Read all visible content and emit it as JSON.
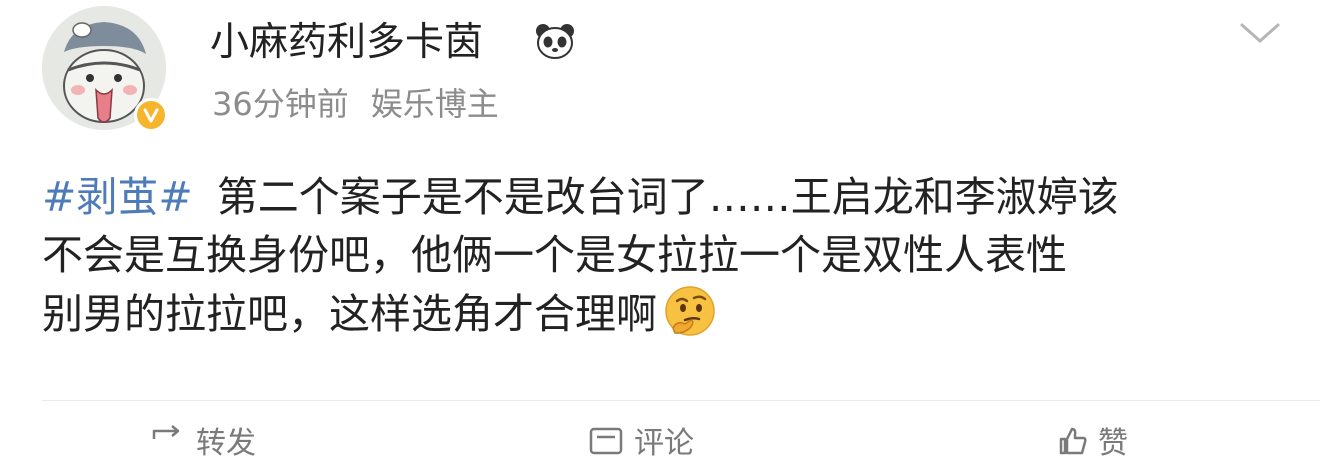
{
  "author": {
    "username": "小麻药利多卡茵",
    "badge_icon": "panda-icon",
    "verified_color": "#f6b52c"
  },
  "meta": {
    "time": "36分钟前",
    "source": "娱乐博主"
  },
  "post": {
    "hashtag": "#剥茧#",
    "line1": "第二个案子是不是改台词了……王启龙和李淑婷该",
    "line2": "不会是互换身份吧，他俩一个是女拉拉一个是双性人表性",
    "line3": "别男的拉拉吧，这样选角才合理啊",
    "emoji_icon": "thinking-face-icon",
    "hashtag_color": "#4f7bb8"
  },
  "actions": {
    "repost_label": "转发",
    "comment_label": "评论",
    "like_label": "赞"
  }
}
